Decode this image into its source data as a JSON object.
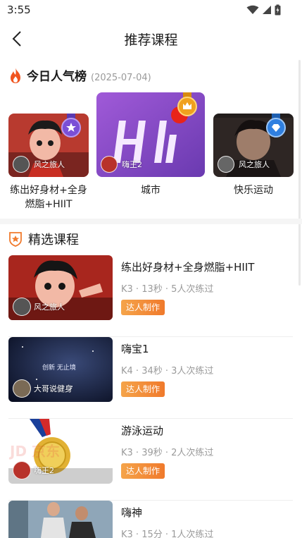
{
  "status": {
    "time": "3:55"
  },
  "header": {
    "title": "推荐课程"
  },
  "ranking": {
    "title": "今日人气榜",
    "date": "(2025-07-04)",
    "items": [
      {
        "author": "风之旅人",
        "label": "练出好身材+全身燃脂+HIIT",
        "medal_color": "#7a4fd6",
        "cover_color": "#b83a2f"
      },
      {
        "author": "嗨王2",
        "label": "城市",
        "medal_color": "#f0a11e",
        "cover_color": "#8b4cc9"
      },
      {
        "author": "风之旅人",
        "label": "快乐运动",
        "medal_color": "#2f7fe0",
        "cover_color": "#3a2d2a"
      }
    ]
  },
  "featured": {
    "title": "精选课程",
    "courses": [
      {
        "title": "练出好身材+全身燃脂+HIIT",
        "meta": "K3 · 13秒 · 5人次练过",
        "badge": "达人制作",
        "author": "风之旅人"
      },
      {
        "title": "嗨宝1",
        "meta": "K4 · 34秒 · 3人次练过",
        "badge": "达人制作",
        "author": "大哥说健身",
        "cover_text": "创新 无止境"
      },
      {
        "title": "游泳运动",
        "meta": "K3 · 39秒 · 2人次练过",
        "badge": "达人制作",
        "author": "嗨王2",
        "cover_text": "JD 京东"
      },
      {
        "title": "嗨神",
        "meta": "K3 · 15分 · 1人次练过"
      }
    ]
  },
  "colors": {
    "accent_orange": "#f07a2c",
    "fire": "#f0541e"
  }
}
